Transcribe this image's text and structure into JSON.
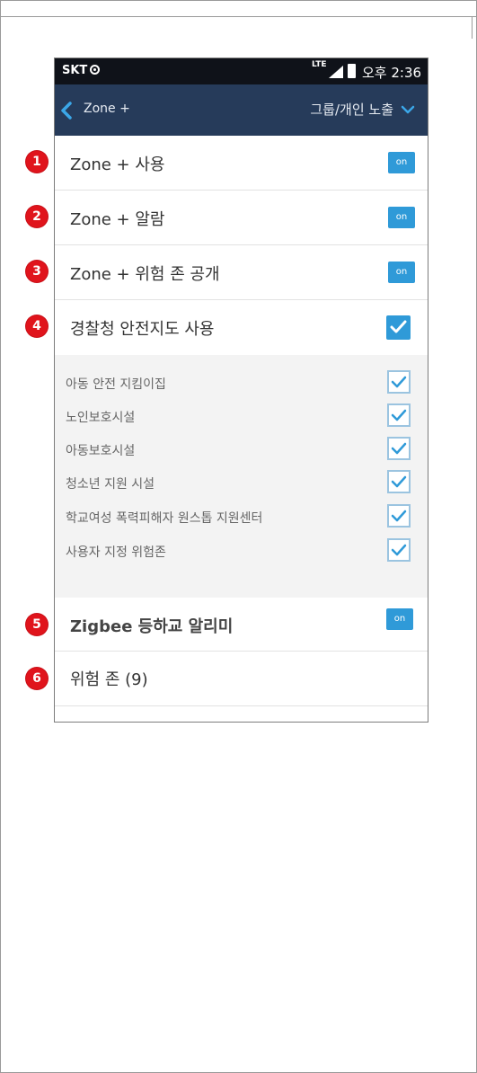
{
  "statusbar": {
    "carrier": "SKT",
    "network": "LTE",
    "time": "오후 2:36"
  },
  "appbar": {
    "back_label": "Zone +",
    "group_label": "그룹/개인 노출"
  },
  "settings": [
    {
      "badge": "1",
      "label": "Zone + 사용",
      "control": "toggle",
      "state": "on"
    },
    {
      "badge": "2",
      "label": "Zone + 알람",
      "control": "toggle",
      "state": "on"
    },
    {
      "badge": "3",
      "label": "Zone + 위험 존 공개",
      "control": "toggle",
      "state": "on"
    },
    {
      "badge": "4",
      "label": "경찰청 안전지도 사용",
      "control": "checkbox",
      "checked": true
    },
    {
      "badge": "5",
      "label": "Zigbee 등하교 알리미",
      "control": "toggle",
      "state": "on"
    },
    {
      "badge": "6",
      "label": "위험 존 (9)"
    }
  ],
  "safety_map_items": [
    {
      "label": "아동 안전 지킴이집",
      "checked": true
    },
    {
      "label": "노인보호시설",
      "checked": true
    },
    {
      "label": "아동보호시설",
      "checked": true
    },
    {
      "label": "청소년 지원 시설",
      "checked": true
    },
    {
      "label": "학교여성 폭력피해자 원스톱 지원센터",
      "checked": true
    },
    {
      "label": "사용자 지정 위험존",
      "checked": true
    }
  ],
  "colors": {
    "appbar": "#263b5a",
    "statusbar": "#0f1219",
    "accent": "#2f9ad8",
    "badge": "#e0141c"
  }
}
